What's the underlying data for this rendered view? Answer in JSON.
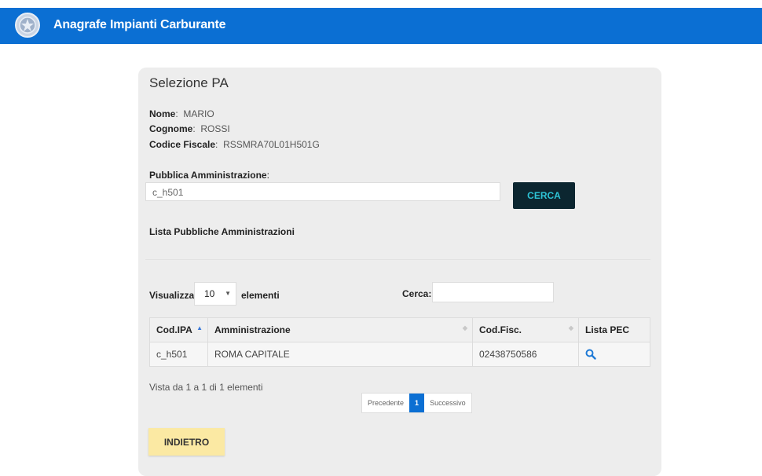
{
  "header": {
    "title": "Anagrafe Impianti Carburante",
    "logo_icon": "emblem-icon",
    "bg_color": "#0b6fd3"
  },
  "card": {
    "title": "Selezione PA",
    "user": [
      {
        "label": "Nome",
        "value": "MARIO"
      },
      {
        "label": "Cognome",
        "value": "ROSSI"
      },
      {
        "label": "Codice Fiscale",
        "value": "RSSMRA70L01H501G"
      }
    ],
    "pa_label": "Pubblica Amministrazione",
    "pa_value": "c_h501",
    "search_button": "CERCA",
    "list_title": "Lista Pubbliche Amministrazioni"
  },
  "table_controls": {
    "show_label": "Visualizza",
    "page_size": "10",
    "elements_label": "elementi",
    "search_label": "Cerca:"
  },
  "table": {
    "headers": [
      "Cod.IPA",
      "Amministrazione",
      "Cod.Fisc.",
      "Lista PEC"
    ],
    "rows": [
      {
        "cod_ipa": "c_h501",
        "amministrazione": "ROMA CAPITALE",
        "cod_fisc": "02438750586",
        "pec_icon": "search-icon"
      }
    ]
  },
  "pagination": {
    "info": "Vista da 1 a 1 di 1 elementi",
    "prev": "Precedente",
    "current": "1",
    "next": "Successivo"
  },
  "back_button": "INDIETRO"
}
